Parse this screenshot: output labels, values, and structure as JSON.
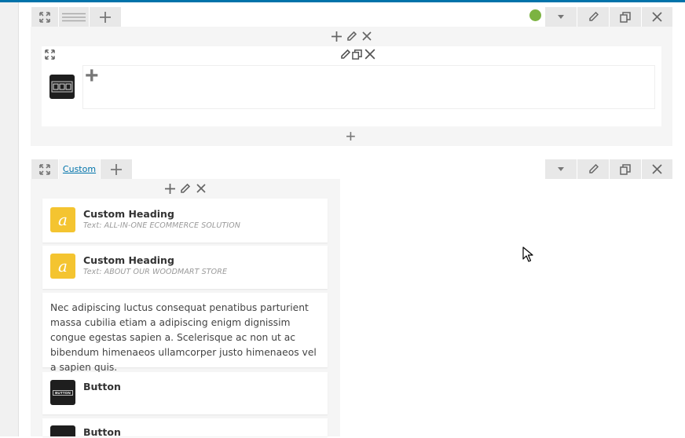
{
  "colors": {
    "accent_bar": "#0073aa",
    "status_dot": "#7cb342",
    "heading_icon_bg": "#f4c430",
    "dark_icon_bg": "#1e1e1e"
  },
  "row1": {
    "toolbar_icons": [
      "move-icon",
      "layout-icon",
      "plus-icon"
    ],
    "right_controls": [
      "status-dot",
      "chevron-down-icon",
      "pencil-icon",
      "clone-icon",
      "close-icon"
    ],
    "column_controls": [
      "plus-icon",
      "pencil-icon",
      "close-icon"
    ],
    "inner_row": {
      "controls": [
        "move-icon",
        "pencil-icon",
        "clone-icon",
        "close-icon"
      ],
      "add_symbol": "+"
    },
    "bottom_add": "+"
  },
  "row2": {
    "tab_label": "Custom",
    "column_controls": [
      "plus-icon",
      "pencil-icon",
      "close-icon"
    ],
    "elements": [
      {
        "type": "heading",
        "title": "Custom Heading",
        "subtitle": "Text: ALL-IN-ONE ECOMMERCE SOLUTION",
        "icon_letter": "a"
      },
      {
        "type": "heading",
        "title": "Custom Heading",
        "subtitle": "Text: ABOUT OUR WOODMART STORE",
        "icon_letter": "a"
      },
      {
        "type": "text",
        "body": "Nec  adipiscing luctus consequat penatibus parturient massa cubilia etiam a adipiscing enigm dignissim congue egestas sapien a. Scelerisque ac non ut ac bibendum himenaeos ullamcorper justo himenaeos vel a sapien quis."
      },
      {
        "type": "button",
        "title": "Button",
        "icon_text": "BUTTON"
      },
      {
        "type": "button",
        "title": "Button",
        "icon_text": "BUTTON"
      }
    ]
  }
}
